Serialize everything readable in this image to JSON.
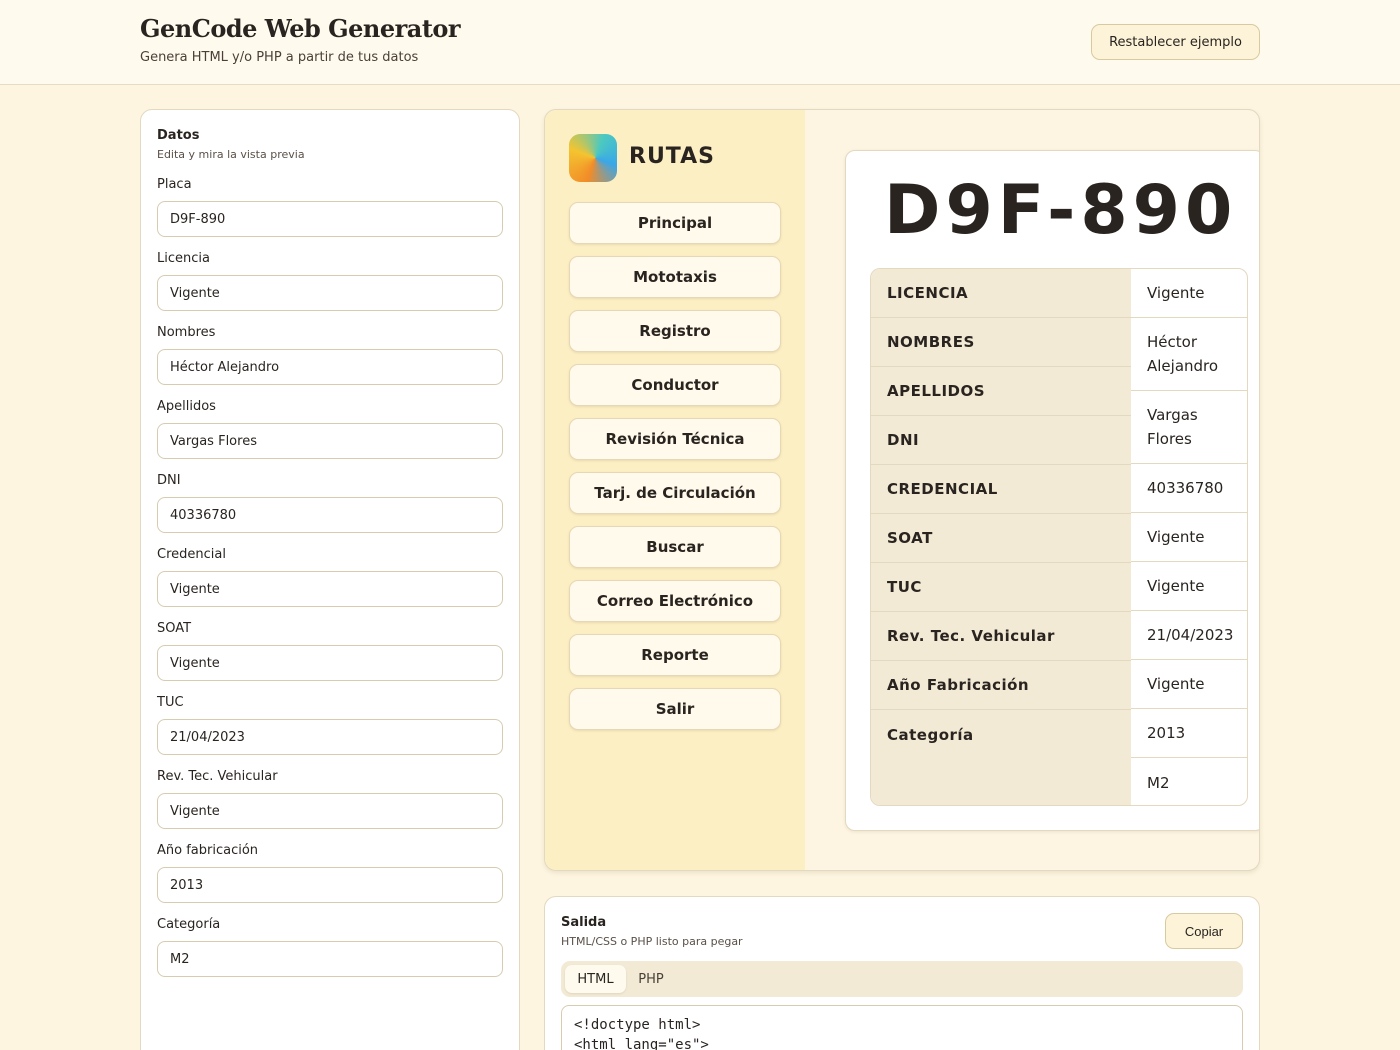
{
  "header": {
    "title": "GenCode Web Generator",
    "subtitle": "Genera HTML y/o PHP a partir de tus datos",
    "reset_label": "Restablecer ejemplo"
  },
  "form": {
    "title": "Datos",
    "subtitle": "Edita y mira la vista previa",
    "fields": [
      {
        "label": "Placa",
        "value": "D9F-890"
      },
      {
        "label": "Licencia",
        "value": "Vigente"
      },
      {
        "label": "Nombres",
        "value": "Héctor Alejandro"
      },
      {
        "label": "Apellidos",
        "value": "Vargas Flores"
      },
      {
        "label": "DNI",
        "value": "40336780"
      },
      {
        "label": "Credencial",
        "value": "Vigente"
      },
      {
        "label": "SOAT",
        "value": "Vigente"
      },
      {
        "label": "TUC",
        "value": "21/04/2023"
      },
      {
        "label": "Rev. Tec. Vehicular",
        "value": "Vigente"
      },
      {
        "label": "Año fabricación",
        "value": "2013"
      },
      {
        "label": "Categoría",
        "value": "M2"
      }
    ]
  },
  "preview": {
    "menu_title": "RUTAS",
    "menu": [
      "Principal",
      "Mototaxis",
      "Registro",
      "Conductor",
      "Revisión Técnica",
      "Tarj. de Circulación",
      "Buscar",
      "Correo Electrónico",
      "Reporte",
      "Salir"
    ],
    "plate": "D9F-890",
    "keys": [
      "LICENCIA",
      "NOMBRES",
      "APELLIDOS",
      "DNI",
      "CREDENCIAL",
      "SOAT",
      "TUC",
      "Rev. Tec. Vehicular",
      "Año Fabricación",
      "Categoría"
    ],
    "values": [
      "Vigente",
      "Héctor Alejandro",
      "Vargas Flores",
      "40336780",
      "Vigente",
      "Vigente",
      "21/04/2023",
      "Vigente",
      "2013",
      "M2"
    ]
  },
  "output": {
    "title": "Salida",
    "subtitle": "HTML/CSS o PHP listo para pegar",
    "copy_label": "Copiar",
    "tabs": [
      "HTML",
      "PHP"
    ],
    "code_lines": [
      "<!doctype html>",
      "<html lang=\"es\">"
    ]
  },
  "colors": {
    "background": "#fdf5e0",
    "sidebar": "#fdefc4",
    "key_column": "#f3ead6"
  },
  "icons": {
    "logo": "gradient-logo-icon"
  }
}
